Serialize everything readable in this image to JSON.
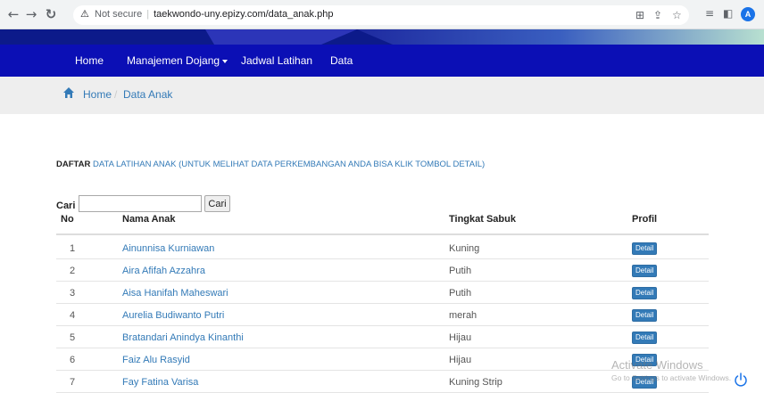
{
  "browser": {
    "security_label": "Not secure",
    "url": "taekwondo-uny.epizy.com/data_anak.php",
    "profile_initial": "A"
  },
  "nav": {
    "items": [
      {
        "label": "Home"
      },
      {
        "label": "Manajemen Dojang"
      },
      {
        "label": "Jadwal Latihan"
      },
      {
        "label": "Data"
      }
    ]
  },
  "breadcrumb": {
    "home": "Home",
    "separator": "/",
    "current": "Data Anak"
  },
  "heading": {
    "strong": "DAFTAR",
    "link": "DATA LATIHAN ANAK (UNTUK MELIHAT DATA PERKEMBANGAN ANDA BISA KLIK TOMBOL DETAIL)"
  },
  "search": {
    "label": "Cari :",
    "value": "",
    "button": "Cari"
  },
  "table": {
    "headers": {
      "no": "No",
      "name": "Nama Anak",
      "belt": "Tingkat Sabuk",
      "profile": "Profil"
    },
    "detail_label": "Detail",
    "rows": [
      {
        "no": "1",
        "name": "Ainunnisa Kurniawan",
        "belt": "Kuning"
      },
      {
        "no": "2",
        "name": "Aira Afifah Azzahra",
        "belt": "Putih"
      },
      {
        "no": "3",
        "name": "Aisa Hanifah Maheswari",
        "belt": "Putih"
      },
      {
        "no": "4",
        "name": "Aurelia Budiwanto Putri",
        "belt": "merah"
      },
      {
        "no": "5",
        "name": "Bratandari Anindya Kinanthi",
        "belt": "Hijau"
      },
      {
        "no": "6",
        "name": "Faiz Alu Rasyid",
        "belt": "Hijau"
      },
      {
        "no": "7",
        "name": "Fay Fatina Varisa",
        "belt": "Kuning Strip"
      }
    ]
  },
  "watermark": {
    "title": "Activate Windows",
    "subtitle": "Go to Settings to activate Windows."
  },
  "colors": {
    "nav_bg": "#0b0fb5",
    "link": "#337ab7",
    "button": "#337ab7"
  }
}
